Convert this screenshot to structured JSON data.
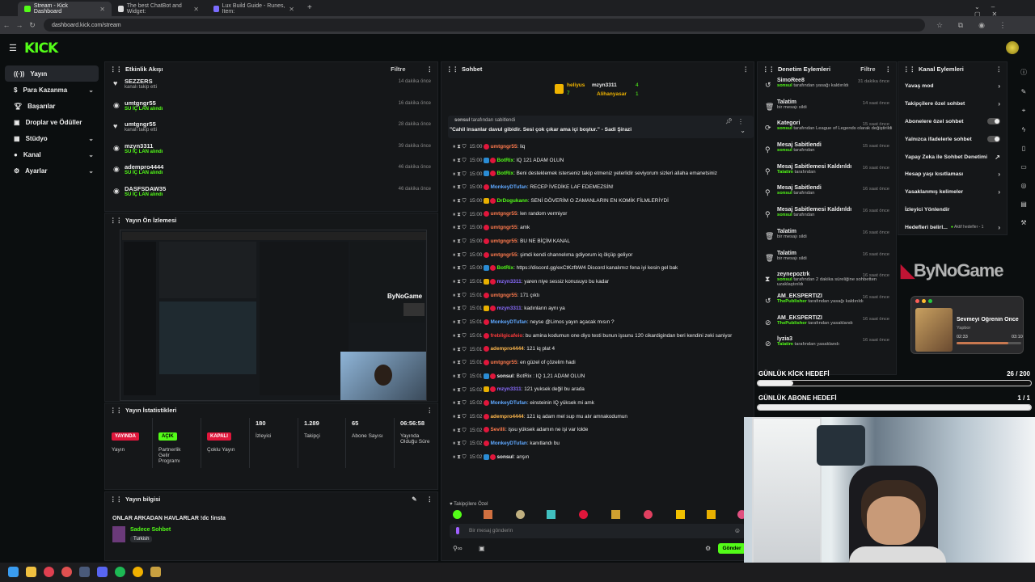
{
  "browser": {
    "tabs": [
      {
        "label": "Stream - Kick Dashboard",
        "active": true
      },
      {
        "label": "The best ChatBot and Widget:",
        "active": false
      },
      {
        "label": "Lux Build Guide - Runes, Item:",
        "active": false
      }
    ],
    "url": "dashboard.kick.com/stream"
  },
  "brand": {
    "logo": "KICK",
    "accent": "#53fc18"
  },
  "sidebar": {
    "items": [
      {
        "label": "Yayın",
        "icon": "broadcast-icon",
        "active": true,
        "has_chevron": false
      },
      {
        "label": "Para Kazanma",
        "icon": "dollar-icon",
        "active": false,
        "has_chevron": true
      },
      {
        "label": "Başarılar",
        "icon": "trophy-icon",
        "active": false,
        "has_chevron": false
      },
      {
        "label": "Droplar ve Ödüller",
        "icon": "gift-icon",
        "active": false,
        "has_chevron": false
      },
      {
        "label": "Stüdyo",
        "icon": "studio-icon",
        "active": false,
        "has_chevron": true
      },
      {
        "label": "Kanal",
        "icon": "user-icon",
        "active": false,
        "has_chevron": true
      },
      {
        "label": "Ayarlar",
        "icon": "gear-icon",
        "active": false,
        "has_chevron": true
      }
    ]
  },
  "activity": {
    "title": "Etkinlik Akışı",
    "filter": "Filtre",
    "rows": [
      {
        "name": "SEZZERS",
        "sub": "kanalı takip etti",
        "time": "14 dakika önce",
        "sub_green": false
      },
      {
        "name": "umtgngr55",
        "sub": "SU İÇ LAN alındı",
        "time": "16 dakika önce",
        "sub_green": true
      },
      {
        "name": "umtgngr55",
        "sub": "kanalı takip etti",
        "time": "28 dakika önce",
        "sub_green": false
      },
      {
        "name": "mzyn3311",
        "sub": "SU İÇ LAN alındı",
        "time": "39 dakika önce",
        "sub_green": true
      },
      {
        "name": "adempro4444",
        "sub": "SU İÇ LAN alındı",
        "time": "46 dakika önce",
        "sub_green": true
      },
      {
        "name": "DASFSDAW35",
        "sub": "SU İÇ LAN alındı",
        "time": "46 dakika önce",
        "sub_green": true
      }
    ]
  },
  "preview": {
    "title": "Yayın Ön İzlemesi",
    "overlay_text": "ByNoGame"
  },
  "stats": {
    "title": "Yayın İstatistikleri",
    "items": [
      {
        "value": "YAYINDA",
        "label": "Yayın",
        "color": "#e0163b"
      },
      {
        "value": "AÇIK",
        "label": "Partnerlik Gelir Programı",
        "color": "#53fc18"
      },
      {
        "value": "KAPALI",
        "label": "Çoklu Yayın",
        "color": "#e0163b"
      },
      {
        "value": "180",
        "label": "İzleyici"
      },
      {
        "value": "1.289",
        "label": "Takipçi"
      },
      {
        "value": "65",
        "label": "Abone Sayısı"
      },
      {
        "value": "06:56:58",
        "label": "Yayında Olduğu Süre"
      }
    ]
  },
  "info": {
    "title": "Yayın bilgisi",
    "stream_title": "ONLAR ARKADAN HAVLARLAR !dc !insta",
    "category": "Sadece Sohbet",
    "tag": "Turkish"
  },
  "chat": {
    "title": "Sohbet",
    "top_gifters": [
      {
        "name": "heliyus",
        "count": "7"
      },
      {
        "name": "mzyn3311",
        "count": "4"
      },
      {
        "name": "Alihanyasar",
        "count": "1"
      }
    ],
    "pinned": {
      "by": "sonsul",
      "by_suffix": "tarafından sabitlendi",
      "text": "\"Cahil insanlar davul gibidir. Sesi çok çıkar ama içi boştur.\" - Sadi Şirazi"
    },
    "messages": [
      {
        "time": "15:00",
        "user": "umtgngr55",
        "color": "#ff7a4d",
        "badge": "",
        "text": "liq"
      },
      {
        "time": "15:00",
        "user": "BotRix",
        "color": "#53fc18",
        "badge": "#2a8cd4",
        "text": "IQ 121 ADAM OLUN"
      },
      {
        "time": "15:00",
        "user": "BotRix",
        "color": "#53fc18",
        "badge": "#2a8cd4",
        "text": "Beni destekleme​k isterseniz takip etmeniz yeterlidir seviyorum sizleri allaha emanetsiniz"
      },
      {
        "time": "15:00",
        "user": "MonkeyDTufan",
        "color": "#5fa8ff",
        "badge": "",
        "text": "RECEP İVEDİKE LAF EDEMEZSİN!"
      },
      {
        "time": "15:00",
        "user": "DrDogukann",
        "color": "#53fc18",
        "badge": "#e8b000",
        "text": "SENİ DÖVERİM O ZAMANLARIN EN KOMİK FİLMLERİYDİ"
      },
      {
        "time": "15:00",
        "user": "umtgngr55",
        "color": "#ff7a4d",
        "badge": "",
        "text": "len random vermiyor"
      },
      {
        "time": "15:00",
        "user": "umtgngr55",
        "color": "#ff7a4d",
        "badge": "",
        "text": "amk"
      },
      {
        "time": "15:00",
        "user": "umtgngr55",
        "color": "#ff7a4d",
        "badge": "",
        "text": "BU NE BİÇİM KANAL"
      },
      {
        "time": "15:00",
        "user": "umtgngr55",
        "color": "#ff7a4d",
        "badge": "",
        "text": "şimdi kendi channelıma gdiyorum iq ölçüp geliyor"
      },
      {
        "time": "15:00",
        "user": "BotRix",
        "color": "#53fc18",
        "badge": "#2a8cd4",
        "text": "https://discord.gg/exCtKzfbW4 Discord kanalımız fena iyi kesin gel bak"
      },
      {
        "time": "15:01",
        "user": "mzyn3311",
        "color": "#8a6cff",
        "badge": "#e8b000",
        "text": "yaren niye sessiz konusuyo bu kadar"
      },
      {
        "time": "15:01",
        "user": "umtgngr55",
        "color": "#ff7a4d",
        "badge": "",
        "text": "171 çıktı"
      },
      {
        "time": "15:01",
        "user": "mzyn3311",
        "color": "#8a6cff",
        "badge": "#e8b000",
        "text": "kadınların aynı ya"
      },
      {
        "time": "15:01",
        "user": "MonkeyDTufan",
        "color": "#5fa8ff",
        "badge": "",
        "text": "neyse @Limos yayın açacak mısın ?"
      },
      {
        "time": "15:01",
        "user": "frebilgicafeio",
        "color": "#ff3b3b",
        "badge": "",
        "text": "bu amina kodumun one diyo testi bunun işsunu 120 cikardigindan beri kendini zeki saniyor"
      },
      {
        "time": "15:01",
        "user": "adempro4444",
        "color": "#ffb84d",
        "badge": "",
        "text": "121 iq plat 4"
      },
      {
        "time": "15:01",
        "user": "umtgngr55",
        "color": "#ff7a4d",
        "badge": "",
        "text": "en güzel of çözelim hadi"
      },
      {
        "time": "15:01",
        "user": "sonsul",
        "color": "#eee",
        "badge": "#2a8cd4",
        "text": "BotRix : IQ 1,21 ADAM OLUN"
      },
      {
        "time": "15:02",
        "user": "mzyn3311",
        "color": "#8a6cff",
        "badge": "#e8b000",
        "text": "121 yuksek değil bu arada"
      },
      {
        "time": "15:02",
        "user": "MonkeyDTufan",
        "color": "#5fa8ff",
        "badge": "",
        "text": "einsteinin IQ yüksek mi amk"
      },
      {
        "time": "15:02",
        "user": "adempro4444",
        "color": "#ffb84d",
        "badge": "",
        "text": "121 iq adam mel sup mu alır amnakodumun"
      },
      {
        "time": "15:02",
        "user": "Sevilli",
        "color": "#ff7a4d",
        "badge": "",
        "text": "işsu yüksek adamın ne işi var lolde"
      },
      {
        "time": "15:02",
        "user": "MonkeyDTufan",
        "color": "#5fa8ff",
        "badge": "",
        "text": "kanıtlandı bu"
      },
      {
        "time": "15:02",
        "user": "sonsul",
        "color": "#eee",
        "badge": "#2a8cd4",
        "text": "anşın"
      }
    ],
    "mode_label": "Takipçilere Özel",
    "input_placeholder": "Bir mesaj gönderin",
    "send_label": "Gönder"
  },
  "modlog": {
    "title": "Denetim Eylemleri",
    "filter": "Filtre",
    "rows": [
      {
        "name": "SimoRee8",
        "actor": "sonsul",
        "desc": "tarafından yasağı kaldırıldı",
        "time": "31 dakika önce",
        "icon": "unban-icon"
      },
      {
        "name": "Talatim",
        "actor": "",
        "desc": "bir mesajı sildi",
        "time": "14 saat önce",
        "icon": "trash-icon"
      },
      {
        "name": "Kategori",
        "actor": "sonsul",
        "desc": "tarafından League of Legends olarak değiştirildi",
        "time": "15 saat önce",
        "icon": "refresh-icon"
      },
      {
        "name": "Mesaj Sabitlendi",
        "actor": "sonsul",
        "desc": "tarafından",
        "time": "15 saat önce",
        "icon": "pin-icon"
      },
      {
        "name": "Mesaj Sabitlemesi Kaldırıldı",
        "actor": "Talatim",
        "desc": "tarafından",
        "time": "16 saat önce",
        "icon": "pin-icon"
      },
      {
        "name": "Mesaj Sabitlendi",
        "actor": "sonsul",
        "desc": "tarafından",
        "time": "16 saat önce",
        "icon": "pin-icon"
      },
      {
        "name": "Mesaj Sabitlemesi Kaldırıldı",
        "actor": "sonsul",
        "desc": "tarafından",
        "time": "16 saat önce",
        "icon": "pin-icon"
      },
      {
        "name": "Talatim",
        "actor": "",
        "desc": "bir mesajı sildi",
        "time": "16 saat önce",
        "icon": "trash-icon"
      },
      {
        "name": "Talatim",
        "actor": "",
        "desc": "bir mesajı sildi",
        "time": "16 saat önce",
        "icon": "trash-icon"
      },
      {
        "name": "zeynepoztrk",
        "actor": "sonsul",
        "desc": "tarafından 2 dakika süreliğine sohbetten uzaklaştırıldı",
        "time": "16 saat önce",
        "icon": "timeout-icon"
      },
      {
        "name": "AM_EKSPERTIZI",
        "actor": "ThePublisher",
        "desc": "tarafından yasağı kaldırıldı",
        "time": "16 saat önce",
        "icon": "unban-icon"
      },
      {
        "name": "AM_EKSPERTIZI",
        "actor": "ThePublisher",
        "desc": "tarafından yasaklandı",
        "time": "16 saat önce",
        "icon": "ban-icon"
      },
      {
        "name": "lyzia3",
        "actor": "Talatim",
        "desc": "tarafından yasaklandı",
        "time": "16 saat önce",
        "icon": "ban-icon"
      }
    ]
  },
  "channel_actions": {
    "title": "Kanal Eylemleri",
    "items": [
      {
        "label": "Yavaş mod",
        "control": "chevron"
      },
      {
        "label": "Takipçilere özel sohbet",
        "control": "chevron"
      },
      {
        "label": "Abonelere özel sohbet",
        "control": "toggle"
      },
      {
        "label": "Yalnızca ifadelerle sohbet",
        "control": "toggle"
      },
      {
        "label": "Yapay Zeka ile Sohbet Denetimi",
        "control": "external"
      },
      {
        "label": "Hesap yaşı kısıtlaması",
        "control": "chevron"
      },
      {
        "label": "Yasaklanmış kelimeler",
        "control": "chevron"
      },
      {
        "label": "İzleyici Yönlendir",
        "control": "none"
      },
      {
        "label": "Hedefleri belirl...",
        "control": "chevron"
      }
    ],
    "goal_badge": "Aktif hedefler - 1"
  },
  "overlay": {
    "brand": "ByNoGame",
    "music": {
      "title": "Sevmeyi Öğrenin Önce",
      "artist": "Yapbor",
      "elapsed": "02:33",
      "total": "03:10",
      "progress": 0.8
    },
    "goals": [
      {
        "label": "GÜNLÜK KİCK HEDEFİ",
        "value": "26 / 200",
        "progress": 0.13
      },
      {
        "label": "GÜNLÜK ABONE HEDEFİ",
        "value": "1 / 1",
        "progress": 1.0
      }
    ]
  }
}
